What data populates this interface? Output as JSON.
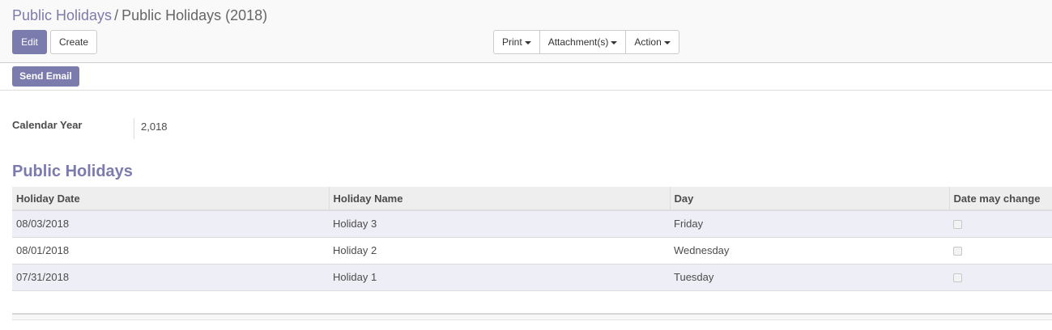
{
  "breadcrumb": {
    "parent": "Public Holidays",
    "separator": "/",
    "current": "Public Holidays (2018)"
  },
  "toolbar": {
    "edit_label": "Edit",
    "create_label": "Create",
    "print_label": "Print",
    "attachments_label": "Attachment(s)",
    "action_label": "Action"
  },
  "statusbar": {
    "send_email_label": "Send Email"
  },
  "form": {
    "calendar_year_label": "Calendar Year",
    "calendar_year_value": "2,018"
  },
  "holidays_section": {
    "title": "Public Holidays",
    "columns": [
      "Holiday Date",
      "Holiday Name",
      "Day",
      "Date may change"
    ],
    "rows": [
      {
        "date": "08/03/2018",
        "name": "Holiday 3",
        "day": "Friday",
        "variable": false
      },
      {
        "date": "08/01/2018",
        "name": "Holiday 2",
        "day": "Wednesday",
        "variable": false
      },
      {
        "date": "07/31/2018",
        "name": "Holiday 1",
        "day": "Tuesday",
        "variable": false
      }
    ]
  },
  "colors": {
    "brand": "#7c7bad",
    "row_highlight": "#eeeef6",
    "header_bg": "#eeeeee"
  }
}
